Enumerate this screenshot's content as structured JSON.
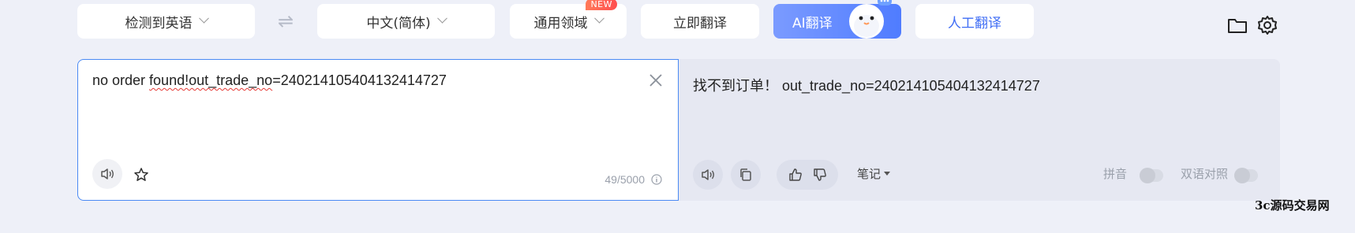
{
  "toolbar": {
    "source_language": "检测到英语",
    "target_language": "中文(简体)",
    "domain": "通用领域",
    "domain_badge": "NEW",
    "translate_now": "立即翻译",
    "ai_translate": "AI翻译",
    "human_translate": "人工翻译"
  },
  "input": {
    "text_prefix": "no order ",
    "text_misspelled": "found!out_trade_no",
    "text_suffix": "=240214105404132414727",
    "char_count": "49/5000"
  },
  "output": {
    "text": "找不到订单！ out_trade_no=240214105404132414727",
    "notes_label": "笔记",
    "pinyin_label": "拼音",
    "bilingual_label": "双语对照"
  },
  "watermark": "3c源码交易网",
  "colors": {
    "accent": "#4f7cff",
    "input_border": "#4a8af4",
    "page_bg": "#eef0f8",
    "output_bg": "#e6e8f2"
  }
}
